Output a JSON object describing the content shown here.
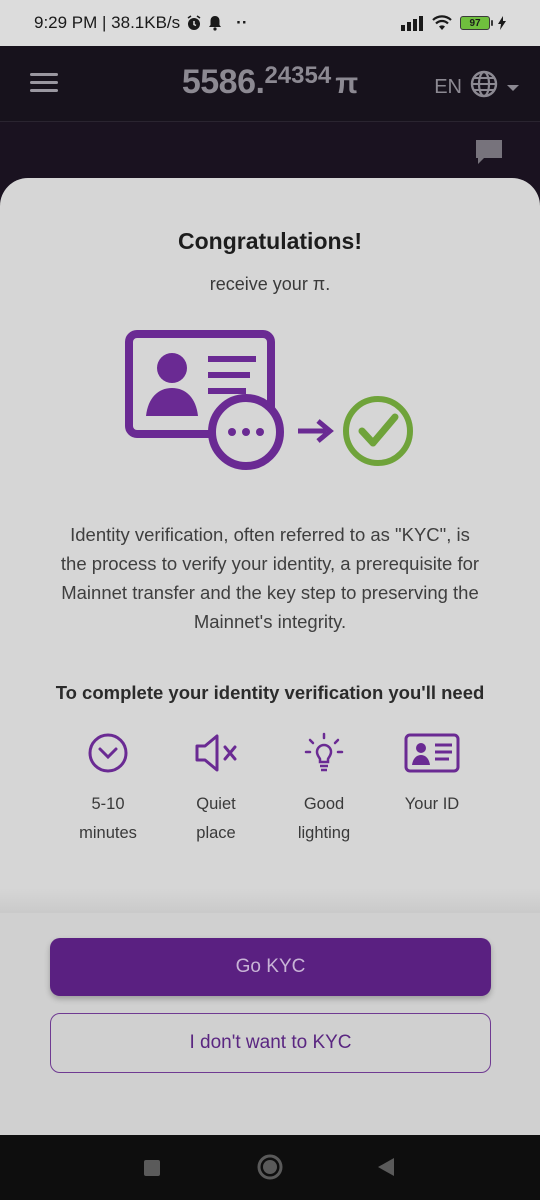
{
  "status_bar": {
    "time_speed": "9:29 PM | 38.1KB/s",
    "more_dots": "··",
    "battery": "97"
  },
  "header": {
    "balance_int": "5586.",
    "balance_dec": "24354",
    "currency_symbol": "π",
    "language": "EN"
  },
  "sheet": {
    "title": "Congratulations!",
    "subtitle": "receive your π.",
    "description": "Identity verification, often referred to as \"KYC\", is the process to verify your identity, a prerequisite for Mainnet transfer and the key step to preserving the Mainnet's integrity.",
    "need_title": "To complete your identity verification you'll need",
    "requirements": [
      {
        "line1": "5-10",
        "line2": "minutes",
        "icon": "clock-icon"
      },
      {
        "line1": "Quiet",
        "line2": "place",
        "icon": "mute-speaker-icon"
      },
      {
        "line1": "Good",
        "line2": "lighting",
        "icon": "lightbulb-icon"
      },
      {
        "line1": "Your ID",
        "line2": "",
        "icon": "id-card-icon"
      }
    ],
    "primary_button": "Go KYC",
    "secondary_button": "I don't want to KYC"
  },
  "colors": {
    "accent_purple": "#5a2081",
    "check_green": "#6fa33a",
    "sheet_bg": "#d6d6d6"
  }
}
